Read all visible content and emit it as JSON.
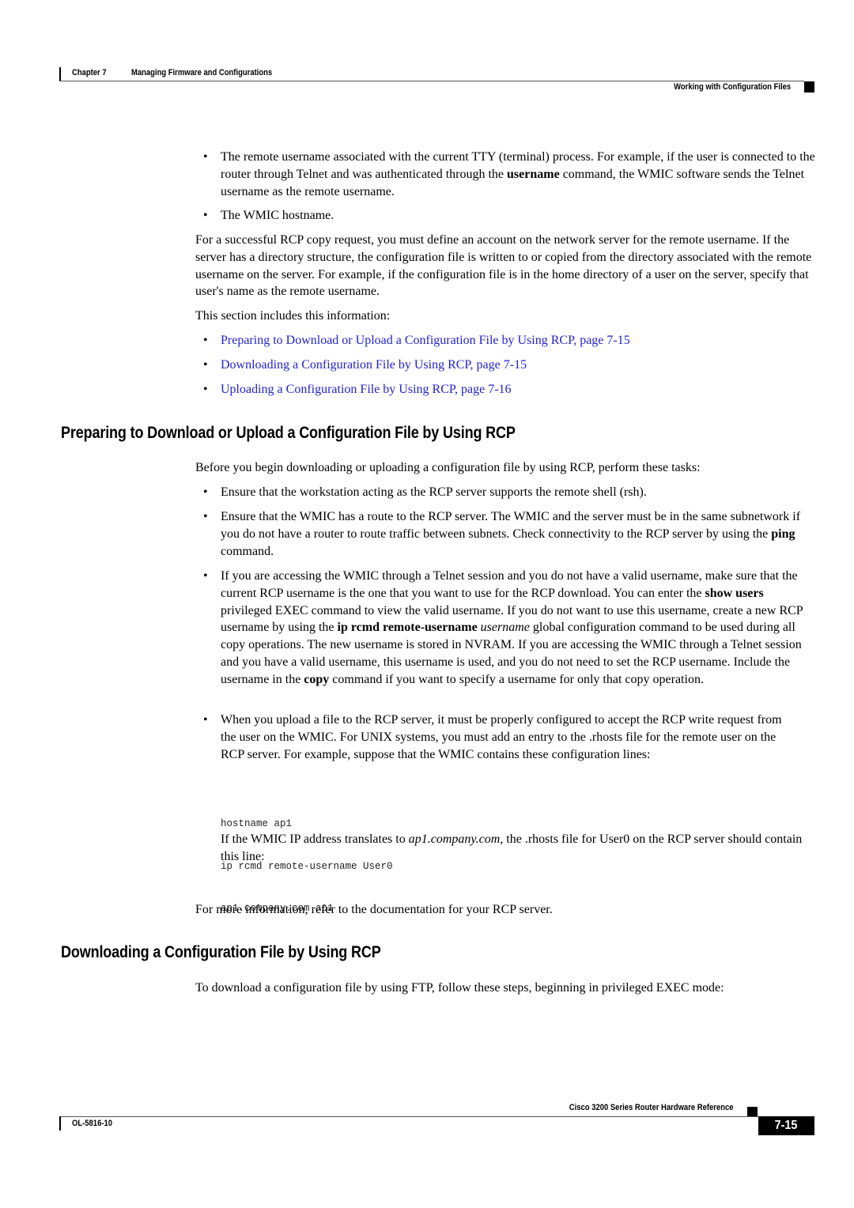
{
  "header": {
    "chapter_label": "Chapter 7",
    "chapter_title": "Managing Firmware and Configurations",
    "section_title": "Working with Configuration Files"
  },
  "intro_bullets": [
    {
      "part1": "The remote username associated with the current TTY (terminal) process. For example, if the user is connected to the router through Telnet and was authenticated through the ",
      "bold1": "username",
      "part2": " command, the WMIC software sends the Telnet username as the remote username."
    },
    {
      "text": "The WMIC hostname."
    }
  ],
  "intro_paragraph": "For a successful RCP copy request, you must define an account on the network server for the remote username. If the server has a directory structure, the configuration file is written to or copied from the directory associated with the remote username on the server. For example, if the configuration file is in the home directory of a user on the server, specify that user's name as the remote username.",
  "section_includes": "This section includes this information:",
  "toc_links": [
    {
      "label": "Preparing to Download or Upload a Configuration File by Using RCP, page 7-15"
    },
    {
      "label": "Downloading a Configuration File by Using RCP, page 7-15"
    },
    {
      "label": "Uploading a Configuration File by Using RCP, page 7-16"
    }
  ],
  "section1": {
    "heading": "Preparing to Download or Upload a Configuration File by Using RCP",
    "lead": "Before you begin downloading or uploading a configuration file by using RCP, perform these tasks:",
    "bullets": [
      {
        "text": "Ensure that the workstation acting as the RCP server supports the remote shell (rsh)."
      },
      {
        "part1": "Ensure that the WMIC has a route to the RCP server. The WMIC and the server must be in the same subnetwork if you do not have a router to route traffic between subnets. Check connectivity to the RCP server by using the ",
        "bold1": "ping",
        "part2": " command."
      },
      {
        "part1": "If you are accessing the WMIC through a Telnet session and you do not have a valid username, make sure that the current RCP username is the one that you want to use for the RCP download. You can enter the ",
        "bold1": "show users",
        "part2": " privileged EXEC command to view the valid username. If you do not want to use this username, create a new RCP username by using the ",
        "bold2": "ip rcmd remote-username",
        "italic1": "username",
        "part3": " global configuration command to be used during all copy operations. The new username is stored in NVRAM. If you are accessing the WMIC through a Telnet session and you have a valid username, this username is used, and you do not need to set the RCP username. Include the username in the ",
        "bold3": "copy",
        "part4": " command if you want to specify a username for only that copy operation."
      },
      {
        "text": "When you upload a file to the RCP server, it must be properly configured to accept the RCP write request from the user on the WMIC. For UNIX systems, you must add an entry to the .rhosts file for the remote user on the RCP server. For example, suppose that the WMIC contains these configuration lines:"
      }
    ],
    "code1": [
      "hostname ap1",
      "ip rcmd remote-username User0"
    ],
    "translate_para": {
      "part1": "If the WMIC IP address translates to ",
      "italic1": "ap1.company.com",
      "part2": ", the .rhosts file for User0 on the RCP server should contain this line:"
    },
    "code2": [
      "ap1.company.com ap1"
    ],
    "closing": "For more information, refer to the documentation for your RCP server."
  },
  "section2": {
    "heading": "Downloading a Configuration File by Using RCP",
    "lead": "To download a configuration file by using FTP, follow these steps, beginning in privileged EXEC mode:"
  },
  "footer": {
    "book_title": "Cisco 3200 Series Router Hardware Reference",
    "doc_number": "OL-5816-10",
    "page_number": "7-15"
  },
  "bullet_glyph": "•"
}
